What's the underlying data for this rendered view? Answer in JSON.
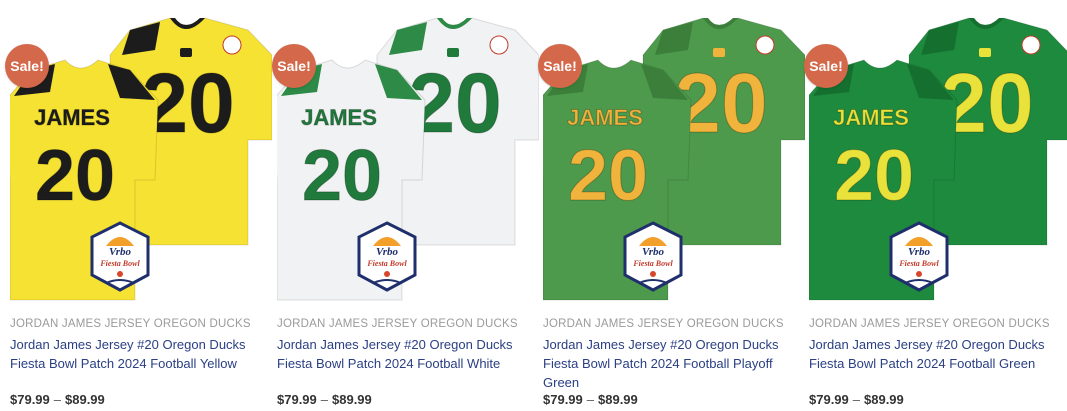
{
  "colors": {
    "sale_badge": "#d3694a",
    "title_link": "#2a3f84",
    "category": "#9a9a9a",
    "price": "#333333"
  },
  "products": [
    {
      "badge": "Sale!",
      "category": "JORDAN JAMES JERSEY OREGON DUCKS",
      "title": "Jordan James Jersey #20 Oregon Ducks Fiesta Bowl Patch 2024 Football Yellow",
      "price_min": "$79.99",
      "price_sep": "–",
      "price_max": "$89.99",
      "jersey": {
        "name": "JAMES",
        "number": "20",
        "base": "#f6e233",
        "accent": "#1c1c1c",
        "trim": "#1c1c1c"
      },
      "patch": {
        "line1": "Vrbo",
        "line2": "Fiesta Bowl"
      }
    },
    {
      "badge": "Sale!",
      "category": "JORDAN JAMES JERSEY OREGON DUCKS",
      "title": "Jordan James Jersey #20 Oregon Ducks Fiesta Bowl Patch 2024 Football White",
      "price_min": "$79.99",
      "price_sep": "–",
      "price_max": "$89.99",
      "jersey": {
        "name": "JAMES",
        "number": "20",
        "base": "#f1f2f3",
        "accent": "#1f7a3c",
        "trim": "#2e8a47"
      },
      "patch": {
        "line1": "Vrbo",
        "line2": "Fiesta Bowl"
      }
    },
    {
      "badge": "Sale!",
      "category": "JORDAN JAMES JERSEY OREGON DUCKS",
      "title": "Jordan James Jersey #20 Oregon Ducks Fiesta Bowl Patch 2024 Football Playoff Green",
      "price_min": "$79.99",
      "price_sep": "–",
      "price_max": "$89.99",
      "jersey": {
        "name": "JAMES",
        "number": "20",
        "base": "#4e9a4c",
        "accent": "#f0b43c",
        "trim": "#3c7f3b"
      },
      "patch": {
        "line1": "Vrbo",
        "line2": "Fiesta Bowl"
      }
    },
    {
      "badge": "Sale!",
      "category": "JORDAN JAMES JERSEY OREGON DUCKS",
      "title": "Jordan James Jersey #20 Oregon Ducks Fiesta Bowl Patch 2024 Football Green",
      "price_min": "$79.99",
      "price_sep": "–",
      "price_max": "$89.99",
      "jersey": {
        "name": "JAMES",
        "number": "20",
        "base": "#1d8a3d",
        "accent": "#e9e23a",
        "trim": "#15702f"
      },
      "patch": {
        "line1": "Vrbo",
        "line2": "Fiesta Bowl"
      }
    }
  ]
}
